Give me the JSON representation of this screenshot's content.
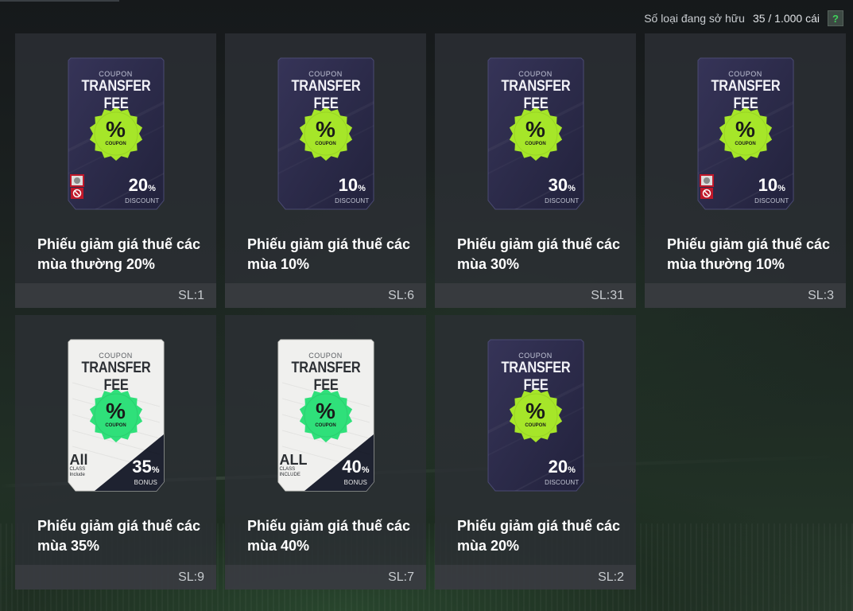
{
  "header": {
    "owned_label": "Số loại đang sở hữu",
    "owned_count": "35 / 1.000 cái",
    "help_label": "?"
  },
  "cards": [
    {
      "title": "Phiếu giảm giá thuế các\nmùa thường 20%",
      "qty": "SL:1",
      "style": "dark",
      "badge": "lime",
      "pct": "20",
      "kind": "DISCOUNT",
      "locked": true
    },
    {
      "title": "Phiếu giảm giá thuế các\nmùa 10%",
      "qty": "SL:6",
      "style": "dark",
      "badge": "lime",
      "pct": "10",
      "kind": "DISCOUNT",
      "locked": false
    },
    {
      "title": "Phiếu giảm giá thuế các\nmùa 30%",
      "qty": "SL:31",
      "style": "dark",
      "badge": "lime",
      "pct": "30",
      "kind": "DISCOUNT",
      "locked": false
    },
    {
      "title": "Phiếu giảm giá thuế các\nmùa thường 10%",
      "qty": "SL:3",
      "style": "dark",
      "badge": "lime",
      "pct": "10",
      "kind": "DISCOUNT",
      "locked": true
    },
    {
      "title": "Phiếu giảm giá thuế các\nmùa 35%",
      "qty": "SL:9",
      "style": "light",
      "badge": "green",
      "pct": "35",
      "kind": "BONUS",
      "locked": false,
      "all_big": "All",
      "all_small": "CLASS",
      "all_small2": "Include"
    },
    {
      "title": "Phiếu giảm giá thuế các\nmùa 40%",
      "qty": "SL:7",
      "style": "light",
      "badge": "green",
      "pct": "40",
      "kind": "BONUS",
      "locked": false,
      "all_big": "ALL",
      "all_small": "CLASS",
      "all_small2": "INCLUDE"
    },
    {
      "title": "Phiếu giảm giá thuế các\nmùa 20%",
      "qty": "SL:2",
      "style": "dark",
      "badge": "lime",
      "pct": "20",
      "kind": "DISCOUNT",
      "locked": false
    }
  ],
  "coupon_text": {
    "small": "COUPON",
    "big": "TRANSFER FEE",
    "badge_symbol": "%",
    "badge_sub": "COUPON",
    "pct_suffix": "%"
  },
  "colors": {
    "dark_card": "#2a2a4a",
    "lime_badge": "#a6e629",
    "green_badge": "#2fe07a",
    "light_card": "#f1f1ef"
  }
}
